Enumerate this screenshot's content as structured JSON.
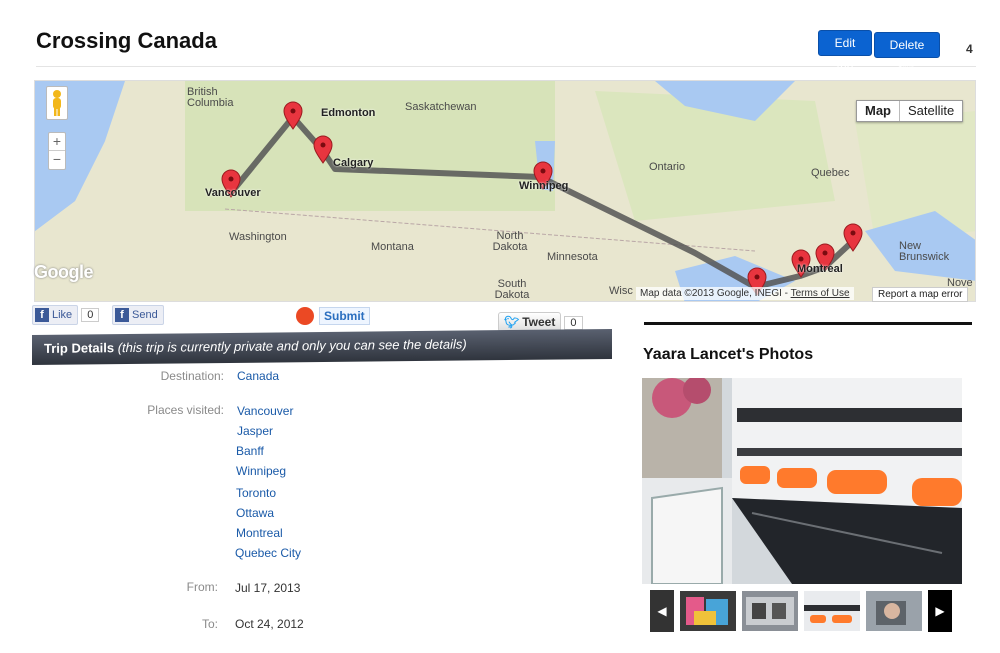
{
  "page": {
    "title": "Crossing Canada",
    "edit_label": "Edit trip",
    "delete_label": "Delete trip",
    "corner_mark": "4"
  },
  "map": {
    "maptype_map": "Map",
    "maptype_satellite": "Satellite",
    "zoom_in": "+",
    "zoom_out": "−",
    "logo": "Google",
    "attribution": "Map data ©2013 Google, INEGI - ",
    "terms": "Terms of Use",
    "report": "Report a map error",
    "labels": {
      "british_columbia": "British Columbia",
      "edmonton": "Edmonton",
      "saskatchewan": "Saskatchewan",
      "calgary": "Calgary",
      "vancouver": "Vancouver",
      "winnipeg": "Winnipeg",
      "ontario": "Ontario",
      "quebec": "Quebec",
      "washington": "Washington",
      "montana": "Montana",
      "north_dakota": "North Dakota",
      "minnesota": "Minnesota",
      "south_dakota": "South Dakota",
      "wisc": "Wisc",
      "montreal": "Montreal",
      "new_brunswick": "New Brunswick",
      "nove": "Nove"
    },
    "route_color": "#555555",
    "marker_color": "#e8353f"
  },
  "social": {
    "like_label": "Like",
    "like_count": "0",
    "send_label": "Send",
    "submit_label": "Submit",
    "tweet_label": "Tweet",
    "tweet_count": "0"
  },
  "details": {
    "bar_title": "Trip Details",
    "bar_note": "(this trip is currently private and only you can see the details)",
    "destination_label": "Destination:",
    "destination": "Canada",
    "places_label": "Places visited:",
    "places": [
      "Vancouver",
      "Jasper",
      "Banff",
      "Winnipeg",
      "Toronto",
      "Ottawa",
      "Montreal",
      "Quebec City"
    ],
    "from_label": "From:",
    "from": "Jul 17, 2013",
    "to_label": "To:",
    "to": "Oct 24, 2012"
  },
  "photos": {
    "title": "Yaara Lancet's Photos",
    "prev_icon": "chevron-left-icon",
    "next_icon": "chevron-right-icon"
  },
  "colors": {
    "button_blue": "#0b63d1",
    "link_blue": "#1a5aa8",
    "details_bar": "#3f4550"
  }
}
